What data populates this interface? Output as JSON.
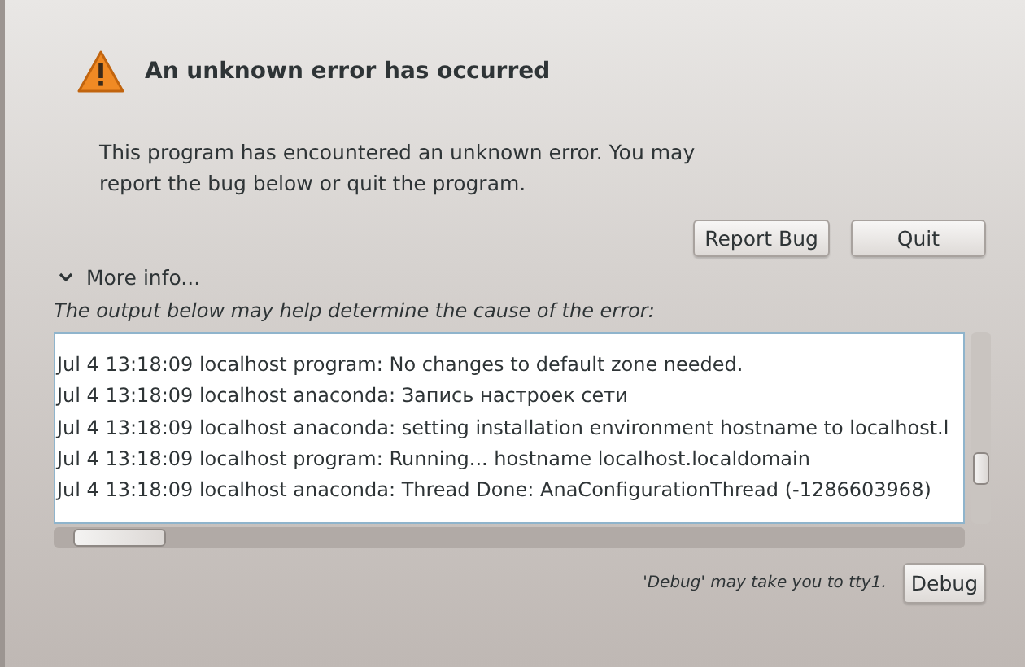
{
  "title": "An unknown error has occurred",
  "message": [
    "This program has encountered an unknown error. You may",
    "report the bug below or quit the program."
  ],
  "buttons": [
    "Report Bug",
    "Quit"
  ],
  "more_info": {
    "label": "More info...",
    "expanded": true
  },
  "output_caption": "The output below may help determine the cause of the error:",
  "log_lines": [
    "Jul  4 13:18:09 localhost program: No changes to default zone needed.",
    "Jul  4 13:18:09 localhost anaconda: Запись настроек сети",
    "Jul  4 13:18:09 localhost anaconda: setting installation environment hostname to localhost.l",
    "Jul  4 13:18:09 localhost program: Running... hostname localhost.localdomain",
    "Jul  4 13:18:09 localhost anaconda: Thread Done: AnaConfigurationThread (-1286603968)"
  ],
  "debug_note": "'Debug' may take you to tty1.",
  "debug_button": "Debug"
}
